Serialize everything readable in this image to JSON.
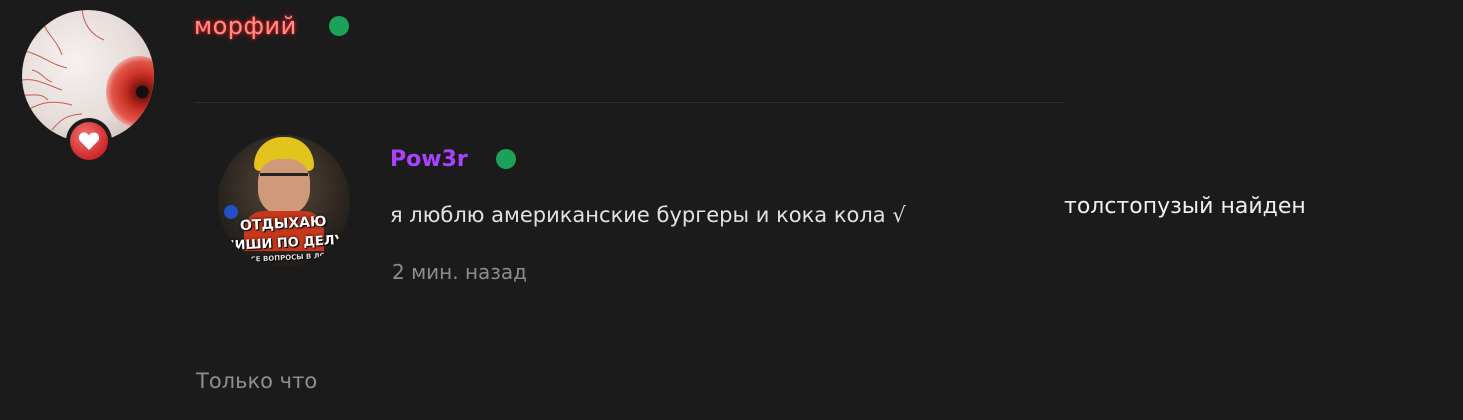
{
  "comment": {
    "author": {
      "name": "морфий",
      "online": true,
      "avatar_icon": "eyeball-avatar",
      "badge_icon": "heart-icon",
      "name_color": "#ff8c88"
    },
    "quote": {
      "author": "Pow3r",
      "online": true,
      "author_color": "#a742ff",
      "avatar_text": {
        "line1": "ОТДЫХАЮ",
        "line2": "ПИШИ ПО ДЕЛУ",
        "line3": "ВСЕ ВОПРОСЫ В ЛС"
      },
      "text": "я люблю американские бургеры и кока кола √",
      "time": "2 мин. назад"
    },
    "text": "толстопузый найден",
    "timestamp": "Только что"
  },
  "colors": {
    "background": "#1b1b1c",
    "online": "#1ba158",
    "divider": "#2c2c2e"
  }
}
